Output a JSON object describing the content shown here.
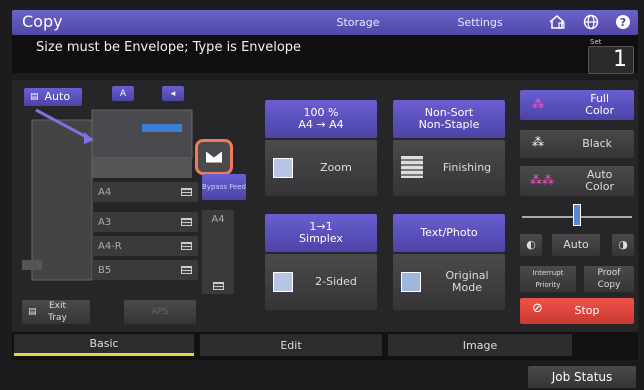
{
  "header": {
    "title": "Copy",
    "storage_label": "Storage",
    "settings_label": "Settings"
  },
  "message": "Size must be Envelope; Type is Envelope",
  "set": {
    "label": "Set",
    "value": "1"
  },
  "left": {
    "auto_label": "Auto",
    "tray_a_label": "A",
    "bypass_label": "Bypass Feed",
    "paper": [
      "A4",
      "A3",
      "A4-R",
      "B5"
    ],
    "bypass_size": "A4",
    "exit_tray_label": "Exit Tray",
    "aps_label": "APS"
  },
  "zoom": {
    "info": "100 %\nA4 → A4",
    "label": "Zoom"
  },
  "finishing": {
    "info": "Non-Sort\nNon-Staple",
    "label": "Finishing"
  },
  "duplex": {
    "info": "1→1\nSimplex",
    "label": "2-Sided"
  },
  "original": {
    "info": "Text/Photo",
    "label": "Original\nMode"
  },
  "color": {
    "full": "Full\nColor",
    "black": "Black",
    "auto": "Auto\nColor"
  },
  "density": {
    "auto_label": "Auto",
    "level": 0.5
  },
  "interrupt_label": "Interrupt\nPriority",
  "proof_label": "Proof\nCopy",
  "stop_label": "Stop",
  "tabs": [
    "Basic",
    "Edit",
    "Image"
  ],
  "job_status_label": "Job Status",
  "colors": {
    "accent": "#5a52c0",
    "stop": "#e0443a",
    "active_tab": "#e7d24a",
    "highlight": "#f07a5a"
  }
}
